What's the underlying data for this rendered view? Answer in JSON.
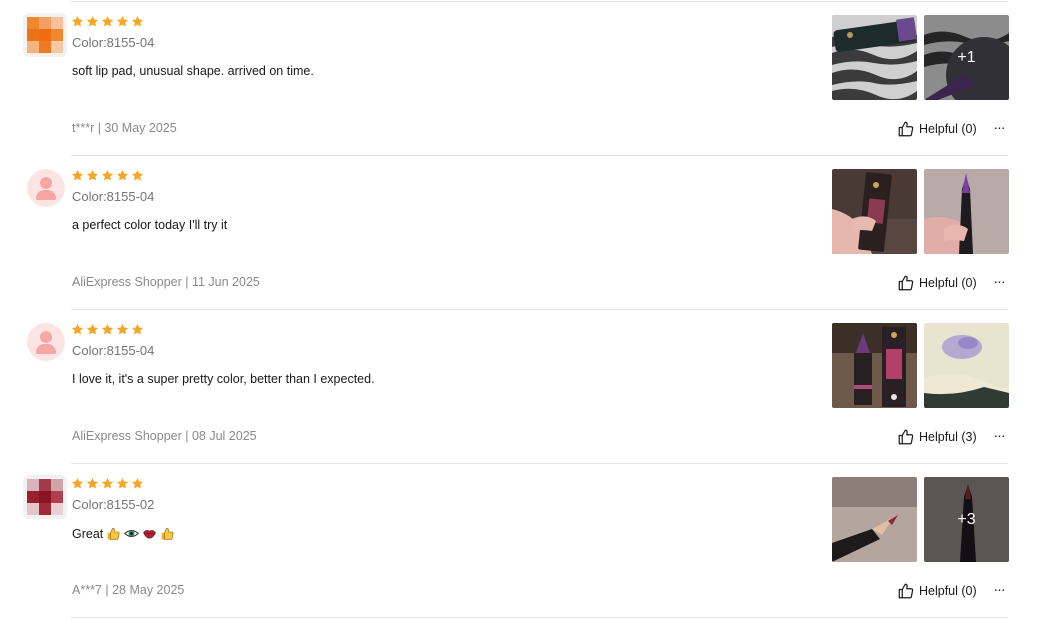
{
  "reviews": [
    {
      "avatar": "pixelated-orange",
      "rating": 5,
      "color_label": "Color:8155-04",
      "text": "soft lip pad, unusual shape. arrived on time.",
      "author": "t***r",
      "date": "30 May 2025",
      "meta": "t***r | 30 May 2025",
      "helpful_label": "Helpful (0)",
      "more_label": "···",
      "extra_photos": "+1"
    },
    {
      "avatar": "default-user",
      "rating": 5,
      "color_label": "Color:8155-04",
      "text": "a perfect color today I'll try it",
      "author": "AliExpress Shopper",
      "date": "11 Jun 2025",
      "meta": "AliExpress Shopper | 11 Jun 2025",
      "helpful_label": "Helpful (0)",
      "more_label": "···",
      "extra_photos": ""
    },
    {
      "avatar": "default-user",
      "rating": 5,
      "color_label": "Color:8155-04",
      "text": "I love it, it's a super pretty color, better than I expected.",
      "author": "AliExpress Shopper",
      "date": "08 Jul 2025",
      "meta": "AliExpress Shopper | 08 Jul 2025",
      "helpful_label": "Helpful (3)",
      "more_label": "···",
      "extra_photos": ""
    },
    {
      "avatar": "pixelated-red",
      "rating": 5,
      "color_label": "Color:8155-02",
      "text": "Great",
      "text_emojis": [
        "thumbs-up",
        "eye",
        "lips",
        "thumbs-up"
      ],
      "author": "A***7",
      "date": "28 May 2025",
      "meta": "A***7 | 28 May 2025",
      "helpful_label": "Helpful (0)",
      "more_label": "···",
      "extra_photos": "+3"
    }
  ],
  "colors": {
    "star": "#f5a623",
    "text": "#191919",
    "muted": "#757575",
    "meta": "#8a8a8a",
    "divider": "#e5e5e5",
    "default_avatar_bg": "#fde4e4",
    "default_avatar_fg": "#f7a6a6"
  },
  "icons": {
    "star": "star-icon",
    "helpful": "thumbs-up-icon",
    "more": "more-dots-icon"
  }
}
